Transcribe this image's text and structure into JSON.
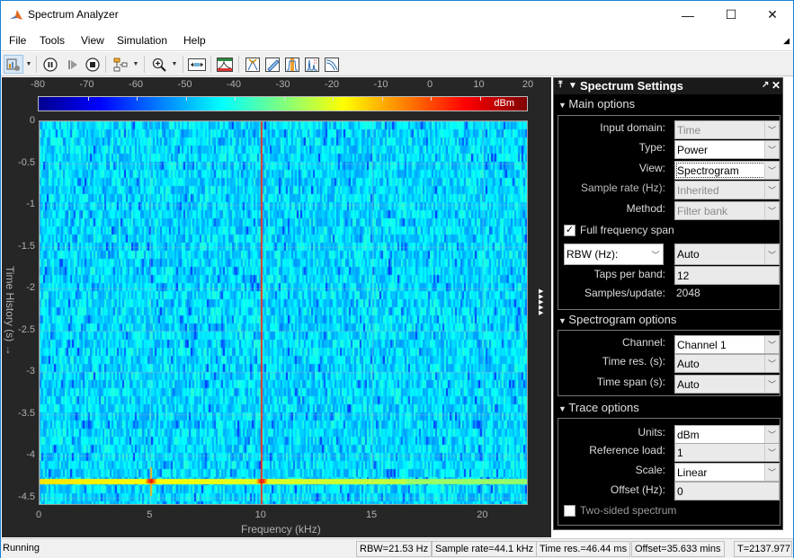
{
  "window": {
    "title": "Spectrum Analyzer",
    "controls": {
      "minimize": "—",
      "maximize": "☐",
      "close": "✕"
    }
  },
  "menu": [
    "File",
    "Tools",
    "View",
    "Simulation",
    "Help"
  ],
  "toolbar": {
    "icons": [
      "settings-icon",
      "dropdown",
      "pause-icon",
      "step-forward-icon",
      "stop-icon",
      "highlight-signal-icon",
      "dropdown",
      "zoom-in-icon",
      "dropdown",
      "scale-axes-icon",
      "spectrum-view-icon",
      "peak-finder-icon",
      "cursor-measurements-icon",
      "channel-measurements-icon",
      "distortion-measurements-icon",
      "ccdf-measurements-icon"
    ]
  },
  "colorbar": {
    "ticks": [
      "-80",
      "-70",
      "-60",
      "-50",
      "-40",
      "-30",
      "-20",
      "-10",
      "0",
      "10",
      "20"
    ],
    "unit": "dBm",
    "colors": [
      "#00008f",
      "#0000ff",
      "#00ffff",
      "#ffff00",
      "#ff0000",
      "#800000"
    ]
  },
  "chart_data": {
    "type": "heatmap",
    "title": "",
    "xlabel": "Frequency (kHz)",
    "ylabel": "Time History (s)",
    "x_ticks": [
      "0",
      "5",
      "10",
      "15",
      "20"
    ],
    "y_ticks": [
      "0",
      "-0.5",
      "-1",
      "-1.5",
      "-2",
      "-2.5",
      "-3",
      "-3.5",
      "-4",
      "-4.5"
    ],
    "xlim": [
      0,
      22.05
    ],
    "ylim": [
      -4.6,
      0
    ],
    "clim": [
      -80,
      20
    ],
    "unit": "dBm",
    "noise_floor_dbm": -45,
    "tones_khz": [
      5,
      10
    ],
    "tone_level_dbm": 10,
    "continuous_tone_khz": 10,
    "burst_time_s": -4.3,
    "grid": true
  },
  "panel": {
    "title": "Spectrum Settings",
    "main": {
      "title": "Main options",
      "input_domain_label": "Input domain:",
      "input_domain": "Time",
      "type_label": "Type:",
      "type": "Power",
      "view_label": "View:",
      "view": "Spectrogram",
      "sample_rate_label": "Sample rate (Hz):",
      "sample_rate": "Inherited",
      "method_label": "Method:",
      "method": "Filter bank",
      "full_span_label": "Full frequency span",
      "full_span_checked": true,
      "rbw_select": "RBW (Hz):",
      "rbw": "Auto",
      "taps_label": "Taps per band:",
      "taps": "12",
      "samples_label": "Samples/update:",
      "samples": "2048"
    },
    "spectrogram": {
      "title": "Spectrogram options",
      "channel_label": "Channel:",
      "channel": "Channel 1",
      "time_res_label": "Time res. (s):",
      "time_res": "Auto",
      "time_span_label": "Time span (s):",
      "time_span": "Auto"
    },
    "trace": {
      "title": "Trace options",
      "units_label": "Units:",
      "units": "dBm",
      "ref_load_label": "Reference load:",
      "ref_load": "1",
      "scale_label": "Scale:",
      "scale": "Linear",
      "offset_label": "Offset (Hz):",
      "offset": "0",
      "two_sided_label": "Two-sided spectrum",
      "two_sided_checked": false
    }
  },
  "status": {
    "state": "Running",
    "rbw": "RBW=21.53 Hz",
    "sample_rate": "Sample rate=44.1 kHz",
    "time_res": "Time res.=46.44 ms",
    "offset": "Offset=35.633 mins",
    "time": "T=2137.977"
  }
}
